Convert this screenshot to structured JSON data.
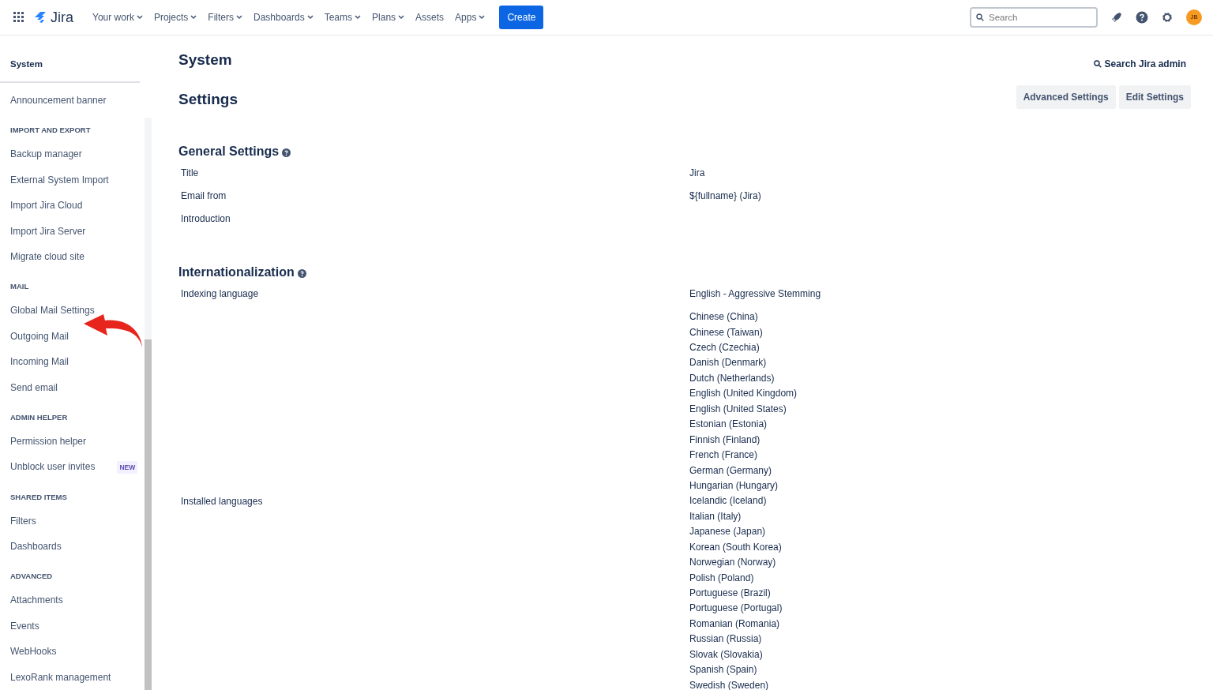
{
  "topbar": {
    "app_name": "Jira",
    "menu": [
      {
        "label": "Your work",
        "dropdown": true
      },
      {
        "label": "Projects",
        "dropdown": true
      },
      {
        "label": "Filters",
        "dropdown": true
      },
      {
        "label": "Dashboards",
        "dropdown": true
      },
      {
        "label": "Teams",
        "dropdown": true
      },
      {
        "label": "Plans",
        "dropdown": true
      },
      {
        "label": "Assets",
        "dropdown": false
      },
      {
        "label": "Apps",
        "dropdown": true
      }
    ],
    "create_button": "Create",
    "search": {
      "placeholder": "Search"
    },
    "avatar": "JB"
  },
  "sidebar": {
    "title": "System",
    "sections": [
      {
        "items": [
          {
            "label": "Announcement banner"
          }
        ]
      },
      {
        "heading": "IMPORT AND EXPORT",
        "items": [
          {
            "label": "Backup manager"
          },
          {
            "label": "External System Import"
          },
          {
            "label": "Import Jira Cloud"
          },
          {
            "label": "Import Jira Server"
          },
          {
            "label": "Migrate cloud site"
          }
        ]
      },
      {
        "heading": "MAIL",
        "items": [
          {
            "label": "Global Mail Settings"
          },
          {
            "label": "Outgoing Mail"
          },
          {
            "label": "Incoming Mail"
          },
          {
            "label": "Send email"
          }
        ]
      },
      {
        "heading": "ADMIN HELPER",
        "items": [
          {
            "label": "Permission helper"
          },
          {
            "label": "Unblock user invites",
            "badge": "NEW"
          }
        ]
      },
      {
        "heading": "SHARED ITEMS",
        "items": [
          {
            "label": "Filters"
          },
          {
            "label": "Dashboards"
          }
        ]
      },
      {
        "heading": "ADVANCED",
        "items": [
          {
            "label": "Attachments"
          },
          {
            "label": "Events"
          },
          {
            "label": "WebHooks"
          },
          {
            "label": "LexoRank management"
          }
        ]
      }
    ]
  },
  "page": {
    "title": "System",
    "admin_search": "Search Jira admin",
    "subtitle": "Settings",
    "buttons": [
      "Advanced Settings",
      "Edit Settings"
    ],
    "groups": [
      {
        "heading": "General Settings",
        "rows": [
          {
            "label": "Title",
            "value": "Jira"
          },
          {
            "label": "Email from",
            "value": "${fullname} (Jira)"
          },
          {
            "label": "Introduction"
          }
        ]
      },
      {
        "heading": "Internationalization",
        "rows": [
          {
            "label": "Indexing language",
            "value": "English - Aggressive Stemming"
          },
          {
            "label": "Installed languages",
            "values": [
              "Chinese (China)",
              "Chinese (Taiwan)",
              "Czech (Czechia)",
              "Danish (Denmark)",
              "Dutch (Netherlands)",
              "English (United Kingdom)",
              "English (United States)",
              "Estonian (Estonia)",
              "Finnish (Finland)",
              "French (France)",
              "German (Germany)",
              "Hungarian (Hungary)",
              "Icelandic (Iceland)",
              "Italian (Italy)",
              "Japanese (Japan)",
              "Korean (South Korea)",
              "Norwegian (Norway)",
              "Polish (Poland)",
              "Portuguese (Brazil)",
              "Portuguese (Portugal)",
              "Romanian (Romania)",
              "Russian (Russia)",
              "Slovak (Slovakia)",
              "Spanish (Spain)",
              "Swedish (Sweden)"
            ]
          }
        ]
      }
    ]
  },
  "annotation": {
    "kind": "arrow"
  }
}
